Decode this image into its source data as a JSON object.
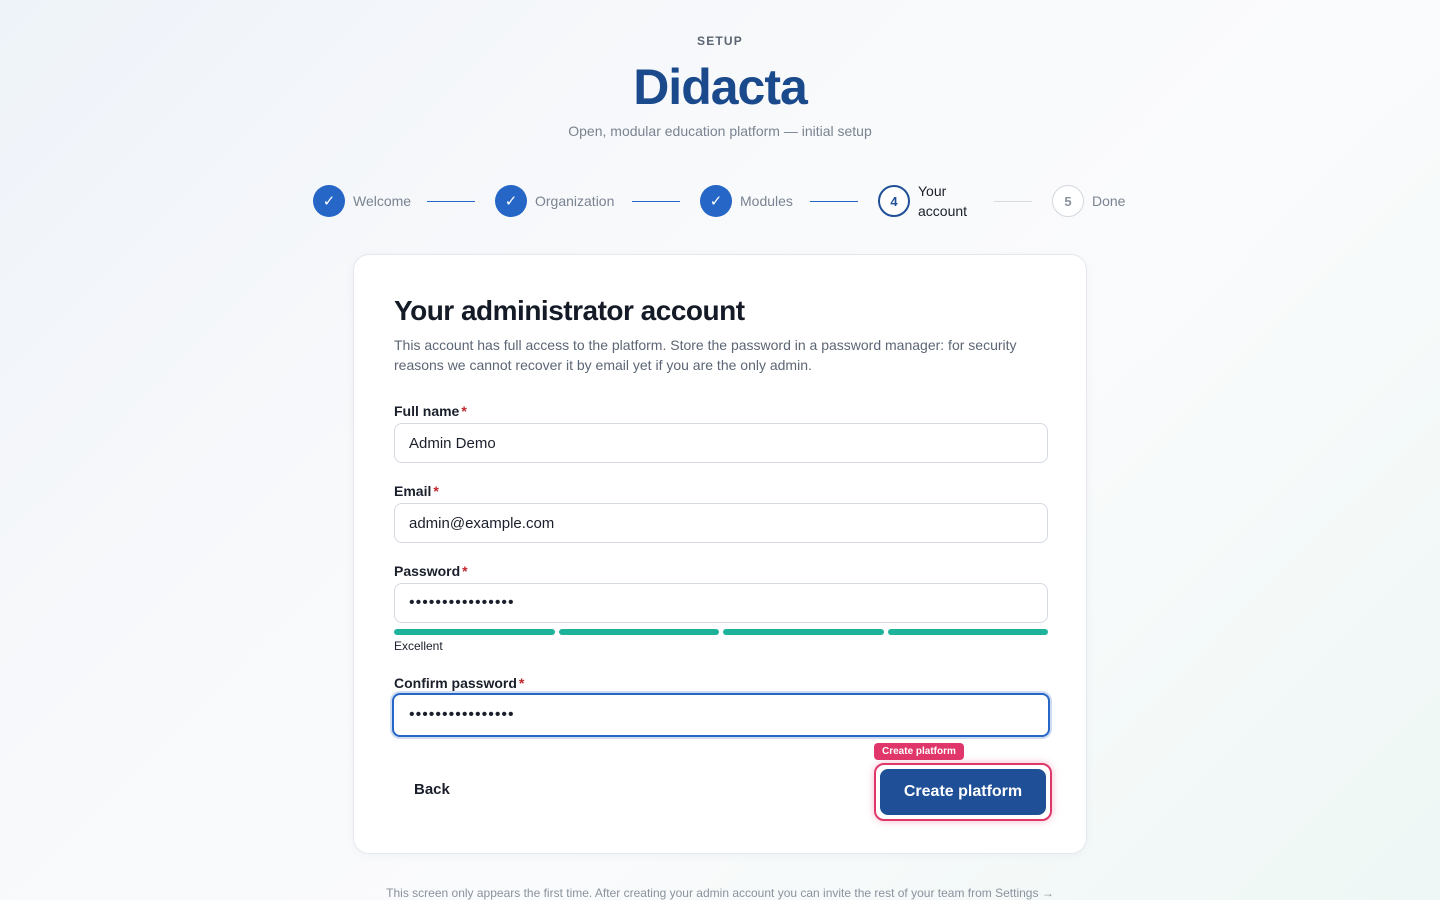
{
  "header": {
    "eyebrow": "SETUP",
    "brand": "Didacta",
    "tagline": "Open, modular education platform — initial setup"
  },
  "stepper": {
    "steps": [
      {
        "number": "1",
        "label": "Welcome",
        "status": "done"
      },
      {
        "number": "2",
        "label": "Organization",
        "status": "done"
      },
      {
        "number": "3",
        "label": "Modules",
        "status": "done"
      },
      {
        "number": "4",
        "label": "Your account",
        "label_line1": "Your",
        "label_line2": "account",
        "status": "current"
      },
      {
        "number": "5",
        "label": "Done",
        "status": "todo"
      }
    ],
    "check_glyph": "✓"
  },
  "card": {
    "title": "Your administrator account",
    "description": "This account has full access to the platform. Store the password in a password manager: for security reasons we cannot recover it by email yet if you are the only admin."
  },
  "form": {
    "full_name": {
      "label": "Full name",
      "required": "*",
      "value": "Admin Demo"
    },
    "email": {
      "label": "Email",
      "required": "*",
      "value": "admin@example.com"
    },
    "password": {
      "label": "Password",
      "required": "*",
      "masked_value": "••••••••••••••••"
    },
    "password_strength": {
      "label": "Excellent",
      "filled_segments": 4,
      "total_segments": 4,
      "color": "#1fb29a"
    },
    "confirm_password": {
      "label": "Confirm password",
      "required": "*",
      "masked_value": "••••••••••••••••"
    }
  },
  "actions": {
    "back_label": "Back",
    "create_label": "Create platform",
    "tooltip": "Create platform"
  },
  "footer": {
    "text": "This screen only appears the first time. After creating your admin account you can invite the rest of your team from Settings →"
  },
  "colors": {
    "brand": "#1b4a8c",
    "primary": "#2566c6",
    "button": "#1f4f97",
    "highlight": "#e0376a",
    "strength": "#1fb29a"
  }
}
